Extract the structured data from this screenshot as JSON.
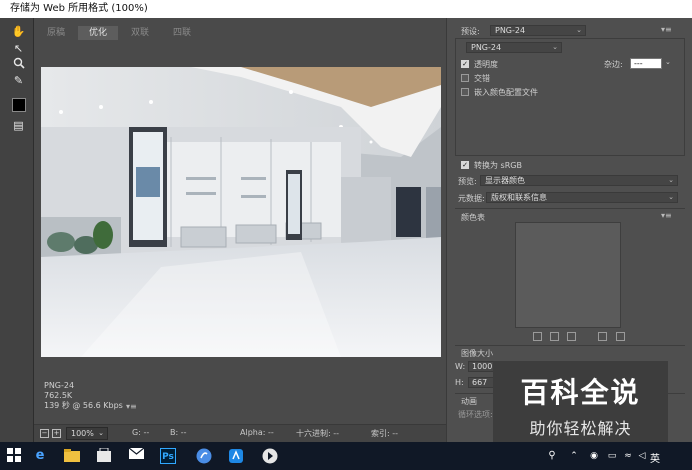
{
  "window": {
    "title": "存储为 Web 所用格式 (100%)"
  },
  "tabs": [
    {
      "label": "原稿",
      "active": false
    },
    {
      "label": "优化",
      "active": true
    },
    {
      "label": "双联",
      "active": false
    },
    {
      "label": "四联",
      "active": false
    }
  ],
  "tools": [
    {
      "name": "hand-tool-icon",
      "glyph": "✋"
    },
    {
      "name": "slice-select-tool-icon",
      "glyph": "↖"
    },
    {
      "name": "zoom-tool-icon",
      "glyph": "🔍"
    },
    {
      "name": "eyedropper-tool-icon",
      "glyph": "✎"
    },
    {
      "name": "toggle-slices-icon",
      "glyph": "▤"
    }
  ],
  "preview_status": {
    "format": "PNG-24",
    "size": "762.5K",
    "download": "139 秒 @ 56.6 Kbps",
    "menu_glyph": "▾≡"
  },
  "bottom_bar": {
    "zoom": "100%",
    "g": "G: --",
    "b": "B: --",
    "alpha": "Alpha: --",
    "hex": "十六进制: --",
    "index": "索引: --"
  },
  "panel": {
    "preset_label": "预设:",
    "preset_value": "PNG-24",
    "format_value": "PNG-24",
    "transparency_label": "透明度",
    "transparency_checked": true,
    "matte_label": "杂边:",
    "matte_value": "---",
    "interlaced_label": "交错",
    "interlaced_checked": false,
    "embed_profile_label": "嵌入颜色配置文件",
    "embed_profile_checked": false,
    "convert_srgb_label": "转换为 sRGB",
    "convert_srgb_checked": true,
    "preview_label": "预览:",
    "preview_value": "显示器颜色",
    "metadata_label": "元数据:",
    "metadata_value": "版权和联系信息",
    "color_table_label": "颜色表",
    "image_size_label": "图像大小",
    "width_label": "W:",
    "width_value": "1000",
    "height_label": "H:",
    "height_value": "667",
    "animation_label": "动画",
    "loop_label": "循环选项:",
    "menu_glyph": "▾≡"
  },
  "watermark": {
    "title": "百科全说",
    "subtitle": "助你轻松解决"
  },
  "taskbar": {
    "language": "英",
    "colors": {
      "background": "#101826",
      "ps_blue": "#31a8ff"
    }
  }
}
